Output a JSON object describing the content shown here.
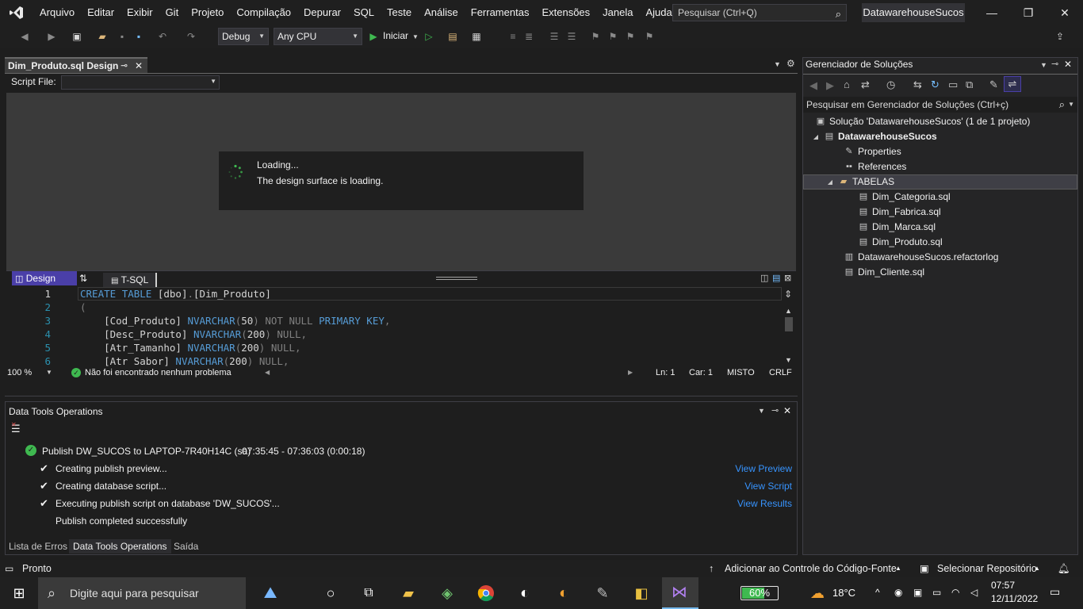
{
  "menubar": {
    "items": [
      "Arquivo",
      "Editar",
      "Exibir",
      "Git",
      "Projeto",
      "Compilação",
      "Depurar",
      "SQL",
      "Teste",
      "Análise",
      "Ferramentas",
      "Extensões",
      "Janela",
      "Ajuda"
    ],
    "search_placeholder": "Pesquisar (Ctrl+Q)",
    "solution_name": "DatawarehouseSucos"
  },
  "toolbar": {
    "config": "Debug",
    "platform": "Any CPU",
    "start_label": "Iniciar"
  },
  "document": {
    "tab_title": "Dim_Produto.sql Design",
    "script_file_label": "Script File:",
    "loading_title": "Loading...",
    "loading_message": "The design surface is loading.",
    "design_tab": "Design",
    "tsql_tab": "T-SQL",
    "code_lines": [
      {
        "n": "1",
        "parts": [
          [
            "kw",
            "CREATE"
          ],
          [
            "",
            " "
          ],
          [
            "kw",
            "TABLE"
          ],
          [
            "",
            " [dbo]"
          ],
          [
            "gray",
            "."
          ],
          [
            "",
            "[Dim_Produto]"
          ]
        ]
      },
      {
        "n": "2",
        "parts": [
          [
            "gray",
            "("
          ]
        ]
      },
      {
        "n": "3",
        "parts": [
          [
            "",
            "    [Cod_Produto] "
          ],
          [
            "kw",
            "NVARCHAR"
          ],
          [
            "gray",
            "("
          ],
          [
            "",
            "50"
          ],
          [
            "gray",
            ")"
          ],
          [
            "",
            " "
          ],
          [
            "gray",
            "NOT NULL"
          ],
          [
            "",
            " "
          ],
          [
            "kw",
            "PRIMARY KEY"
          ],
          [
            "gray",
            ","
          ]
        ]
      },
      {
        "n": "4",
        "parts": [
          [
            "",
            "    [Desc_Produto] "
          ],
          [
            "kw",
            "NVARCHAR"
          ],
          [
            "gray",
            "("
          ],
          [
            "",
            "200"
          ],
          [
            "gray",
            ")"
          ],
          [
            "",
            " "
          ],
          [
            "gray",
            "NULL,"
          ]
        ]
      },
      {
        "n": "5",
        "parts": [
          [
            "",
            "    [Atr_Tamanho] "
          ],
          [
            "kw",
            "NVARCHAR"
          ],
          [
            "gray",
            "("
          ],
          [
            "",
            "200"
          ],
          [
            "gray",
            ")"
          ],
          [
            "",
            " "
          ],
          [
            "gray",
            "NULL,"
          ]
        ]
      },
      {
        "n": "6",
        "parts": [
          [
            "",
            "    [Atr_Sabor] "
          ],
          [
            "kw",
            "NVARCHAR"
          ],
          [
            "gray",
            "("
          ],
          [
            "",
            "200"
          ],
          [
            "gray",
            ")"
          ],
          [
            "",
            " "
          ],
          [
            "gray",
            "NULL,"
          ]
        ]
      }
    ],
    "zoom": "100 %",
    "problems": "Não foi encontrado nenhum problema",
    "line": "Ln: 1",
    "char": "Car: 1",
    "mixed": "MISTO",
    "eol": "CRLF"
  },
  "ops": {
    "title": "Data Tools Operations",
    "publish_line": "Publish DW_SUCOS to LAPTOP-7R40H14C (sa)",
    "publish_time": "07:35:45 - 07:36:03 (0:00:18)",
    "steps": [
      {
        "text": "Creating publish preview...",
        "link": "View Preview"
      },
      {
        "text": "Creating database script...",
        "link": "View Script"
      },
      {
        "text": "Executing publish script on database 'DW_SUCOS'...",
        "link": "View Results"
      }
    ],
    "completed": "Publish completed successfully",
    "tabs": [
      "Lista de Erros",
      "Data Tools Operations",
      "Saída"
    ]
  },
  "solution_explorer": {
    "title": "Gerenciador de Soluções",
    "search_placeholder": "Pesquisar em Gerenciador de Soluções (Ctrl+ç)",
    "solution": "Solução 'DatawarehouseSucos' (1 de 1 projeto)",
    "project": "DatawarehouseSucos",
    "properties": "Properties",
    "references": "References",
    "folder": "TABELAS",
    "files": [
      "Dim_Categoria.sql",
      "Dim_Fabrica.sql",
      "Dim_Marca.sql",
      "Dim_Produto.sql"
    ],
    "refactorlog": "DatawarehouseSucos.refactorlog",
    "cliente": "Dim_Cliente.sql"
  },
  "statusbar": {
    "ready": "Pronto",
    "source_control": "Adicionar ao Controle do Código-Fonte",
    "repository": "Selecionar Repositório"
  },
  "taskbar": {
    "search_placeholder": "Digite aqui para pesquisar",
    "battery": "60%",
    "temperature": "18°C",
    "time": "07:57",
    "date": "12/11/2022"
  },
  "colors": {
    "accent": "#4a3fa8",
    "link": "#3794ff",
    "success": "#3fb950",
    "keyword": "#569cd6"
  }
}
